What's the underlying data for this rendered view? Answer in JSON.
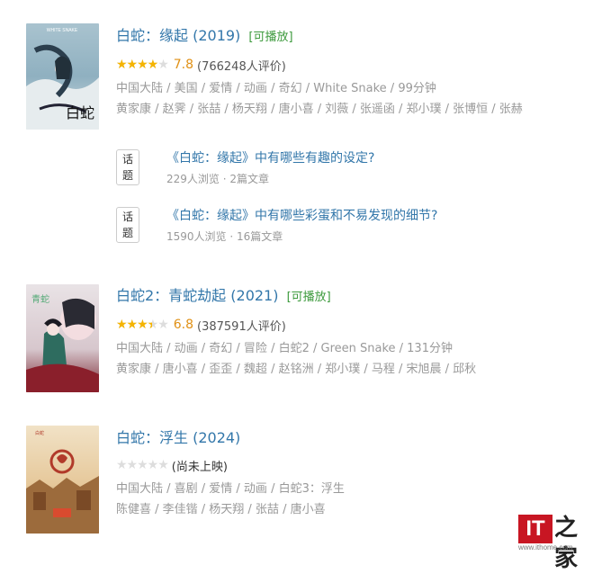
{
  "movies": [
    {
      "title": "白蛇：缘起 (2019)",
      "playable": "[可播放]",
      "rating": 7.8,
      "stars_fraction": 0.8,
      "score_text": "7.8",
      "votes_text": "(766248人评价)",
      "meta1": "中国大陆 / 美国 / 爱情 / 动画 / 奇幻 / White Snake / 99分钟",
      "meta2": "黄家康 / 赵霁 / 张喆 / 杨天翔 / 唐小喜 / 刘薇 / 张遥函 / 郑小璞 / 张博恒 / 张赫",
      "topics": [
        {
          "tag": "话题",
          "title": "《白蛇：缘起》中有哪些有趣的设定?",
          "sub": "229人浏览 · 2篇文章"
        },
        {
          "tag": "话题",
          "title": "《白蛇：缘起》中有哪些彩蛋和不易发现的细节?",
          "sub": "1590人浏览 · 16篇文章"
        }
      ],
      "poster_caption": "WHITE SNAKE"
    },
    {
      "title": "白蛇2：青蛇劫起 (2021)",
      "playable": "[可播放]",
      "rating": 6.8,
      "stars_fraction": 0.7,
      "score_text": "6.8",
      "votes_text": "(387591人评价)",
      "meta1": "中国大陆 / 动画 / 奇幻 / 冒险 / 白蛇2 / Green Snake / 131分钟",
      "meta2": "黄家康 / 唐小喜 / 歪歪 / 魏超 / 赵铭洲 / 郑小璞 / 马程 / 宋旭晨 / 邱秋"
    },
    {
      "title": "白蛇：浮生 (2024)",
      "playable": "",
      "rating": null,
      "stars_fraction": 0,
      "score_text": "",
      "votes_text": "(尚未上映)",
      "meta1": "中国大陆 / 喜剧 / 爱情 / 动画 / 白蛇3：浮生",
      "meta2": "陈健喜 / 李佳锴 / 杨天翔 / 张喆 / 唐小喜"
    }
  ],
  "stars_glyph": "★★★★★",
  "watermark": {
    "it": "IT",
    "cn": "之家",
    "url": "www.ithome.com"
  },
  "colors": {
    "link": "#3377aa",
    "playable": "#3d9a3d",
    "star": "#f5b400",
    "score": "#e09015",
    "meta": "#999999",
    "brand_red": "#c81623"
  }
}
